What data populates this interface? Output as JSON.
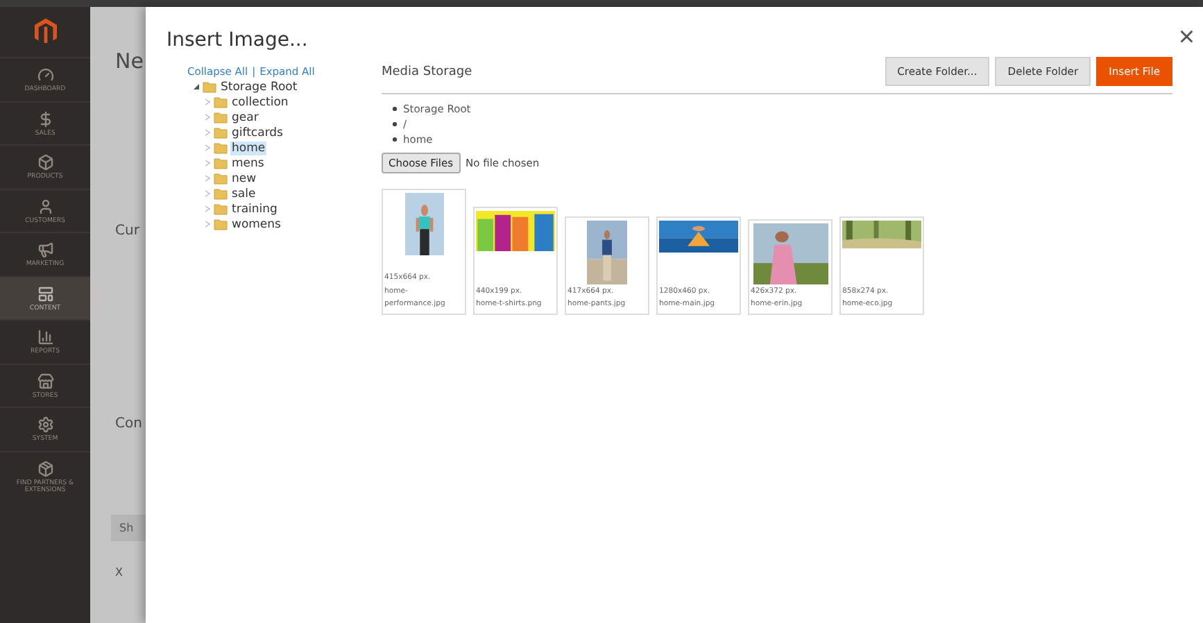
{
  "sidebar": {
    "items": [
      {
        "label": "DASHBOARD",
        "selected": false
      },
      {
        "label": "SALES",
        "selected": false
      },
      {
        "label": "PRODUCTS",
        "selected": false
      },
      {
        "label": "CUSTOMERS",
        "selected": false
      },
      {
        "label": "MARKETING",
        "selected": false
      },
      {
        "label": "CONTENT",
        "selected": true
      },
      {
        "label": "REPORTS",
        "selected": false
      },
      {
        "label": "STORES",
        "selected": false
      },
      {
        "label": "SYSTEM",
        "selected": false
      },
      {
        "label": "FIND PARTNERS & EXTENSIONS",
        "selected": false
      }
    ]
  },
  "background_page": {
    "heading": "Ne",
    "section_1": "Cur",
    "section_2": "Con",
    "button": "Sh",
    "row_mark": "X"
  },
  "modal": {
    "title": "Insert Image...",
    "close": "×",
    "tree": {
      "collapse_all": "Collapse All",
      "separator": "|",
      "expand_all": "Expand All",
      "nodes": [
        {
          "label": "Storage Root",
          "expanded": true,
          "selected": false,
          "children": [
            {
              "label": "collection",
              "expanded": false,
              "selected": false
            },
            {
              "label": "gear",
              "expanded": false,
              "selected": false
            },
            {
              "label": "giftcards",
              "expanded": false,
              "selected": false
            },
            {
              "label": "home",
              "expanded": false,
              "selected": true
            },
            {
              "label": "mens",
              "expanded": false,
              "selected": false
            },
            {
              "label": "new",
              "expanded": false,
              "selected": false
            },
            {
              "label": "sale",
              "expanded": false,
              "selected": false
            },
            {
              "label": "training",
              "expanded": false,
              "selected": false
            },
            {
              "label": "womens",
              "expanded": false,
              "selected": false
            }
          ]
        }
      ]
    },
    "content": {
      "heading": "Media Storage",
      "buttons": [
        {
          "label": "Create Folder...",
          "kind": "secondary"
        },
        {
          "label": "Delete Folder",
          "kind": "secondary"
        },
        {
          "label": "Insert File",
          "kind": "primary"
        }
      ],
      "breadcrumbs": [
        "Storage Root",
        "/",
        "home"
      ],
      "file_input": {
        "button": "Choose Files",
        "status": "No file chosen"
      },
      "files": [
        {
          "dimensions": "415x664 px.",
          "name": "home-performance.jpg"
        },
        {
          "dimensions": "440x199 px.",
          "name": "home-t-shirts.png"
        },
        {
          "dimensions": "417x664 px.",
          "name": "home-pants.jpg"
        },
        {
          "dimensions": "1280x460 px.",
          "name": "home-main.jpg"
        },
        {
          "dimensions": "426x372 px.",
          "name": "home-erin.jpg"
        },
        {
          "dimensions": "858x274 px.",
          "name": "home-eco.jpg"
        }
      ]
    }
  }
}
